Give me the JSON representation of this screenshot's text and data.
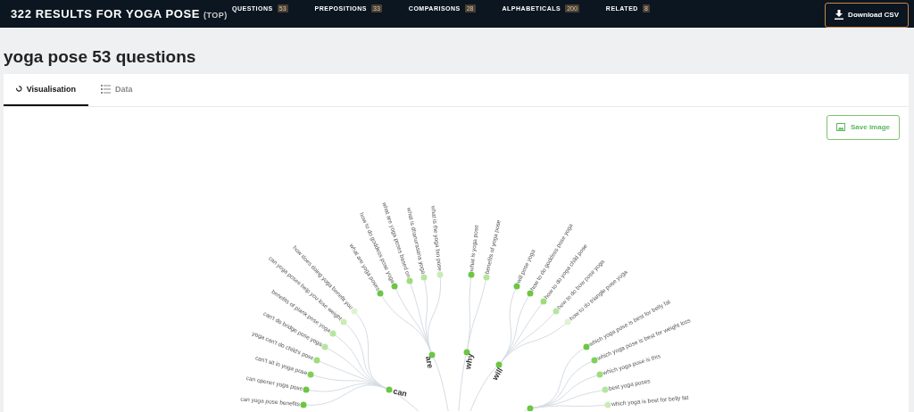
{
  "header": {
    "title": "322 RESULTS FOR YOGA POSE",
    "qualifier": "(TOP)",
    "nav": [
      {
        "label": "QUESTIONS",
        "count": "53"
      },
      {
        "label": "PREPOSITIONS",
        "count": "33"
      },
      {
        "label": "COMPARISONS",
        "count": "28"
      },
      {
        "label": "ALPHABETICALS",
        "count": "200"
      },
      {
        "label": "RELATED",
        "count": "8"
      }
    ],
    "download_button": "Download CSV"
  },
  "heading": "yoga pose 53 questions",
  "view_tabs": [
    {
      "label": "Visualisation",
      "selected": true,
      "kind": "chart"
    },
    {
      "label": "Data",
      "selected": false,
      "kind": "list"
    }
  ],
  "save_button": "Save image",
  "tree": {
    "branches": [
      {
        "label": "can",
        "leaves": [
          {
            "text": "can yoga pose benefits",
            "color": "#6cc644"
          },
          {
            "text": "can opener yoga pose",
            "color": "#6cc644"
          },
          {
            "text": "can't sit in yoga pose",
            "color": "#7fd05a"
          },
          {
            "text": "yoga can't do child's pose",
            "color": "#9edc7c"
          },
          {
            "text": "can't do bridge pose yoga",
            "color": "#b5e6a0"
          },
          {
            "text": "benefits of plank pose yoga",
            "color": "#b5e6a0"
          },
          {
            "text": "can yoga poses help you lose weight",
            "color": "#c9ecb5"
          },
          {
            "text": "how does doing yoga benefit you",
            "color": "#ddf3d0"
          }
        ]
      },
      {
        "label": "are",
        "leaves": [
          {
            "text": "what are yoga poses",
            "color": "#6cc644"
          },
          {
            "text": "how to do goddess pose yoga",
            "color": "#6cc644"
          },
          {
            "text": "what are yoga poses based on",
            "color": "#9edc7c"
          },
          {
            "text": "what is dhanurasana yoga",
            "color": "#b5e6a0"
          },
          {
            "text": "what is the yoga fan pose",
            "color": "#c9ecb5"
          }
        ]
      },
      {
        "label": "why",
        "leaves": [
          {
            "text": "what is yoga pose",
            "color": "#6cc644"
          },
          {
            "text": "benefits of yoga pose",
            "color": "#b5e6a0"
          }
        ]
      },
      {
        "label": "will",
        "leaves": [
          {
            "text": "will pose yoga",
            "color": "#6cc644"
          },
          {
            "text": "how to do goddess pose yoga",
            "color": "#6cc644"
          },
          {
            "text": "how to do yoga child pose",
            "color": "#9edc7c"
          },
          {
            "text": "how to do bow pose yoga",
            "color": "#b5e6a0"
          },
          {
            "text": "how to do triangle pose yoga",
            "color": "#ddf3d0"
          }
        ]
      },
      {
        "leaves": [
          {
            "text": "which yoga pose is best for belly fat",
            "color": "#6cc644"
          },
          {
            "text": "which yoga pose is best for weight loss",
            "color": "#7fd05a"
          },
          {
            "text": "which yoga pose is this",
            "color": "#9edc7c"
          },
          {
            "text": "best yoga poses",
            "color": "#b5e6a0"
          },
          {
            "text": "which yoga is best for belly fat",
            "color": "#c9ecb5"
          }
        ]
      }
    ]
  }
}
